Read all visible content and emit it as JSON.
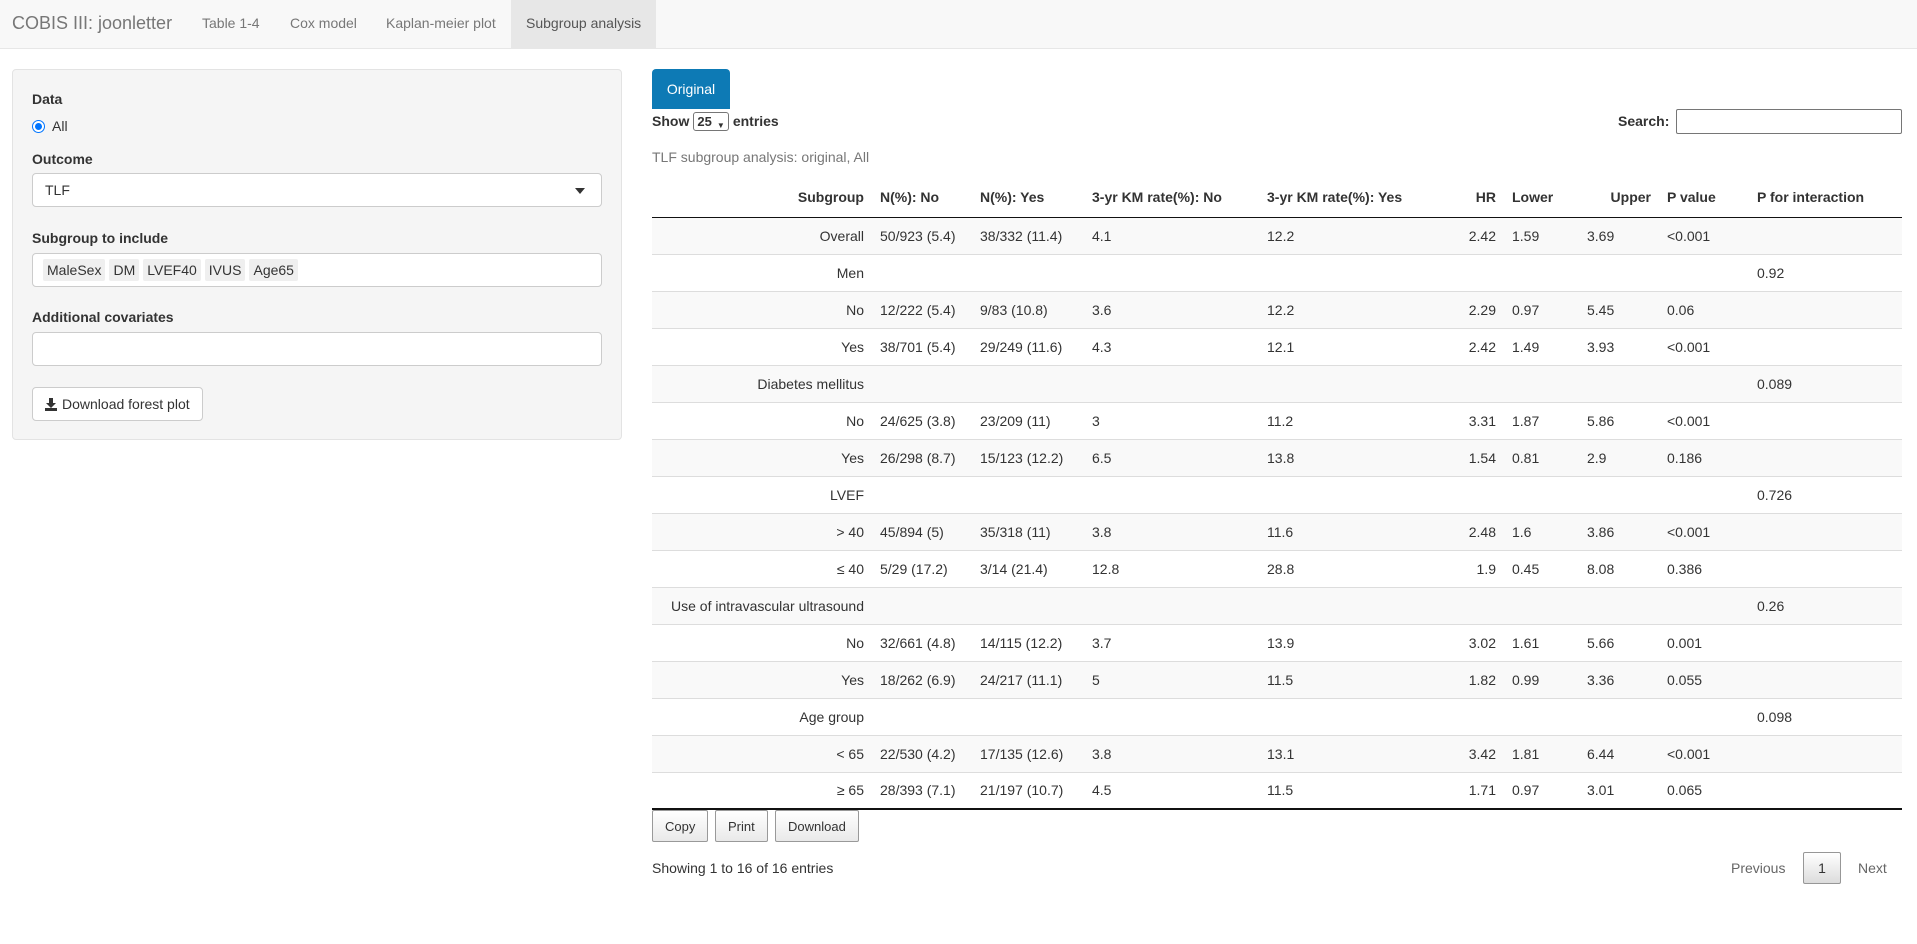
{
  "navbar": {
    "brand": "COBIS III: joonletter",
    "tabs": [
      {
        "label": "Table 1-4"
      },
      {
        "label": "Cox model"
      },
      {
        "label": "Kaplan-meier plot"
      },
      {
        "label": "Subgroup analysis",
        "active": true
      }
    ]
  },
  "sidebar": {
    "data_label": "Data",
    "data_option": "All",
    "outcome_label": "Outcome",
    "outcome_value": "TLF",
    "subgroup_label": "Subgroup to include",
    "subgroup_tags": [
      "MaleSex",
      "DM",
      "LVEF40",
      "IVUS",
      "Age65"
    ],
    "covariates_label": "Additional covariates",
    "covariates_value": "",
    "download_label": "Download forest plot"
  },
  "main": {
    "tab_label": "Original",
    "show_label": "Show",
    "entries_label": "entries",
    "page_length": "25",
    "search_label": "Search:",
    "search_value": "",
    "caption": "TLF subgroup analysis: original, All",
    "columns": [
      "Subgroup",
      "N(%): No",
      "N(%): Yes",
      "3-yr KM rate(%): No",
      "3-yr KM rate(%): Yes",
      "HR",
      "Lower",
      "Upper",
      "P value",
      "P for interaction"
    ],
    "rows": [
      [
        "Overall",
        "50/923 (5.4)",
        "38/332 (11.4)",
        "4.1",
        "12.2",
        "2.42",
        "1.59",
        "3.69",
        "<0.001",
        ""
      ],
      [
        "Men",
        "",
        "",
        "",
        "",
        "",
        "",
        "",
        "",
        "0.92"
      ],
      [
        "No",
        "12/222 (5.4)",
        "9/83 (10.8)",
        "3.6",
        "12.2",
        "2.29",
        "0.97",
        "5.45",
        "0.06",
        ""
      ],
      [
        "Yes",
        "38/701 (5.4)",
        "29/249 (11.6)",
        "4.3",
        "12.1",
        "2.42",
        "1.49",
        "3.93",
        "<0.001",
        ""
      ],
      [
        "Diabetes mellitus",
        "",
        "",
        "",
        "",
        "",
        "",
        "",
        "",
        "0.089"
      ],
      [
        "No",
        "24/625 (3.8)",
        "23/209 (11)",
        "3",
        "11.2",
        "3.31",
        "1.87",
        "5.86",
        "<0.001",
        ""
      ],
      [
        "Yes",
        "26/298 (8.7)",
        "15/123 (12.2)",
        "6.5",
        "13.8",
        "1.54",
        "0.81",
        "2.9",
        "0.186",
        ""
      ],
      [
        "LVEF",
        "",
        "",
        "",
        "",
        "",
        "",
        "",
        "",
        "0.726"
      ],
      [
        "> 40",
        "45/894 (5)",
        "35/318 (11)",
        "3.8",
        "11.6",
        "2.48",
        "1.6",
        "3.86",
        "<0.001",
        ""
      ],
      [
        "≤ 40",
        "5/29 (17.2)",
        "3/14 (21.4)",
        "12.8",
        "28.8",
        "1.9",
        "0.45",
        "8.08",
        "0.386",
        ""
      ],
      [
        "Use of intravascular ultrasound",
        "",
        "",
        "",
        "",
        "",
        "",
        "",
        "",
        "0.26"
      ],
      [
        "No",
        "32/661 (4.8)",
        "14/115 (12.2)",
        "3.7",
        "13.9",
        "3.02",
        "1.61",
        "5.66",
        "0.001",
        ""
      ],
      [
        "Yes",
        "18/262 (6.9)",
        "24/217 (11.1)",
        "5",
        "11.5",
        "1.82",
        "0.99",
        "3.36",
        "0.055",
        ""
      ],
      [
        "Age group",
        "",
        "",
        "",
        "",
        "",
        "",
        "",
        "",
        "0.098"
      ],
      [
        "< 65",
        "22/530 (4.2)",
        "17/135 (12.6)",
        "3.8",
        "13.1",
        "3.42",
        "1.81",
        "6.44",
        "<0.001",
        ""
      ],
      [
        "≥ 65",
        "28/393 (7.1)",
        "21/197 (10.7)",
        "4.5",
        "11.5",
        "1.71",
        "0.97",
        "3.01",
        "0.065",
        ""
      ]
    ],
    "buttons": {
      "copy": "Copy",
      "print": "Print",
      "download": "Download"
    },
    "info": "Showing 1 to 16 of 16 entries",
    "pager": {
      "previous": "Previous",
      "page": "1",
      "next": "Next"
    }
  }
}
